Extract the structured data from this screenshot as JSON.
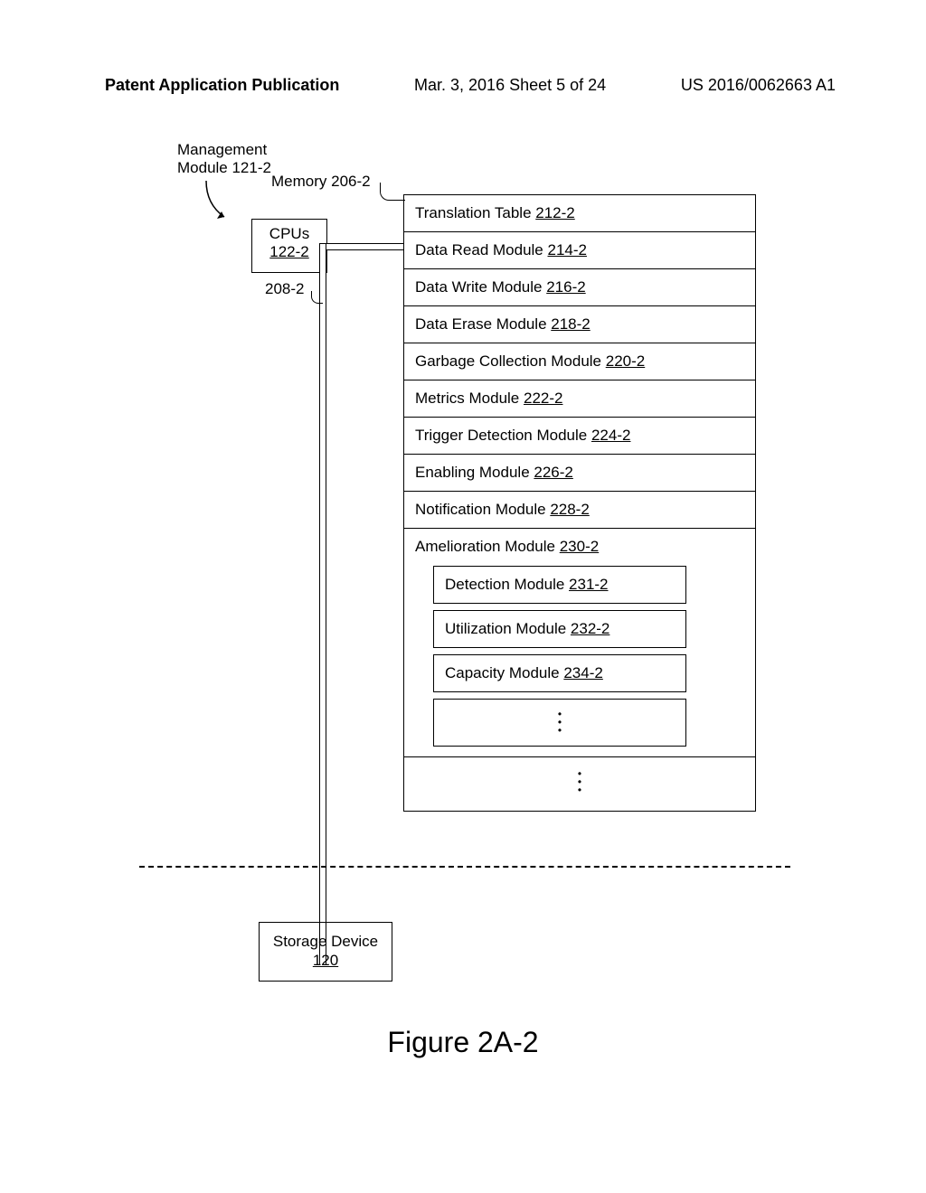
{
  "header": {
    "left": "Patent Application Publication",
    "center": "Mar. 3, 2016  Sheet 5 of 24",
    "right": "US 2016/0062663 A1"
  },
  "labels": {
    "management_module": "Management\nModule 121-2",
    "memory": "Memory 206-2",
    "bus": "208-2",
    "figure": "Figure 2A-2"
  },
  "cpu": {
    "title": "CPUs",
    "ref": "122-2"
  },
  "storage": {
    "title": "Storage Device",
    "ref": "120"
  },
  "memory_items": [
    {
      "label": "Translation Table ",
      "ref": "212-2"
    },
    {
      "label": "Data Read Module ",
      "ref": "214-2"
    },
    {
      "label": "Data Write Module ",
      "ref": "216-2"
    },
    {
      "label": "Data Erase Module ",
      "ref": "218-2"
    },
    {
      "label": "Garbage Collection Module ",
      "ref": "220-2"
    },
    {
      "label": "Metrics Module ",
      "ref": "222-2"
    },
    {
      "label": "Trigger Detection Module ",
      "ref": "224-2"
    },
    {
      "label": "Enabling Module ",
      "ref": "226-2"
    },
    {
      "label": "Notification Module ",
      "ref": "228-2"
    }
  ],
  "amelioration": {
    "label": "Amelioration Module ",
    "ref": "230-2",
    "sub": [
      {
        "label": "Detection Module ",
        "ref": "231-2"
      },
      {
        "label": "Utilization Module ",
        "ref": "232-2"
      },
      {
        "label": "Capacity Module ",
        "ref": "234-2"
      }
    ]
  }
}
